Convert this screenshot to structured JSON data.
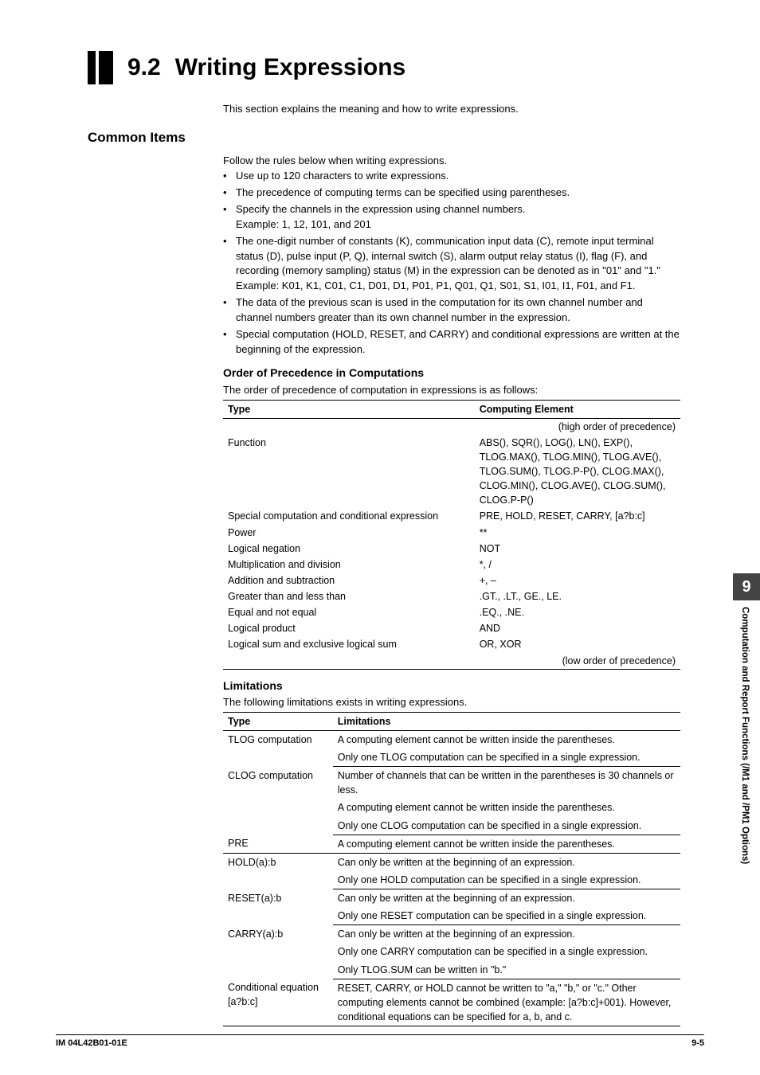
{
  "section": {
    "number": "9.2",
    "title": "Writing Expressions"
  },
  "intro": "This section explains the meaning and how to write expressions.",
  "common": {
    "heading": "Common Items",
    "lead": "Follow the rules below when writing expressions.",
    "bullets": {
      "b1": "Use up to 120 characters to write expressions.",
      "b2": "The precedence of computing terms can be specified using parentheses.",
      "b3a": "Specify the channels in the expression using channel numbers.",
      "b3b": "Example: 1, 12, 101, and 201",
      "b4a": "The one-digit number of constants (K), communication input data (C), remote input terminal status (D), pulse input (P, Q), internal switch (S), alarm output relay status (I), flag (F), and recording (memory sampling) status (M) in the expression can be denoted as in \"01\" and \"1.\"",
      "b4b": "Example: K01, K1, C01, C1, D01, D1, P01, P1, Q01, Q1, S01, S1, I01, I1, F01, and F1.",
      "b5": "The data of the previous scan is used in the computation for its own channel number and channel numbers greater than its own channel number in the expression.",
      "b6": "Special computation (HOLD, RESET, and CARRY) and conditional expressions are written at the beginning of the expression."
    }
  },
  "precedence": {
    "heading": "Order of Precedence in Computations",
    "lead": "The order of precedence of computation in expressions is as follows:",
    "headers": {
      "h1": "Type",
      "h2": "Computing Element"
    },
    "high": "(high order of precedence)",
    "rows": {
      "r1a": "Function",
      "r1b": "ABS(), SQR(), LOG(), LN(), EXP(), TLOG.MAX(), TLOG.MIN(), TLOG.AVE(), TLOG.SUM(), TLOG.P-P(), CLOG.MAX(), CLOG.MIN(), CLOG.AVE(), CLOG.SUM(), CLOG.P-P()",
      "r2a": "Special computation and conditional expression",
      "r2b": "PRE, HOLD, RESET, CARRY, [a?b:c]",
      "r3a": "Power",
      "r3b": "**",
      "r4a": "Logical negation",
      "r4b": "NOT",
      "r5a": "Multiplication and division",
      "r5b": "*, /",
      "r6a": "Addition and subtraction",
      "r6b": "+, –",
      "r7a": "Greater than and less than",
      "r7b": ".GT., .LT., GE., LE.",
      "r8a": "Equal and not equal",
      "r8b": ".EQ., .NE.",
      "r9a": "Logical product",
      "r9b": "AND",
      "r10a": "Logical sum and exclusive logical sum",
      "r10b": "OR, XOR"
    },
    "low": "(low order of precedence)"
  },
  "limits": {
    "heading": "Limitations",
    "lead": "The following limitations exists in writing expressions.",
    "headers": {
      "h1": "Type",
      "h2": "Limitations"
    },
    "rows": {
      "r1a": "TLOG computation",
      "r1b1": "A computing element cannot be written inside the parentheses.",
      "r1b2": "Only one TLOG computation can be specified in a single expression.",
      "r2a": "CLOG computation",
      "r2b1": "Number of channels that can be written in the parentheses is 30 channels or less.",
      "r2b2": "A computing element cannot be written inside the parentheses.",
      "r2b3": "Only one CLOG computation can be specified in a single expression.",
      "r3a": "PRE",
      "r3b": "A computing element cannot be written inside the parentheses.",
      "r4a": "HOLD(a):b",
      "r4b1": "Can only be written at the beginning of an expression.",
      "r4b2": "Only one HOLD computation can be specified in a single expression.",
      "r5a": "RESET(a):b",
      "r5b1": "Can only be written at the beginning of an expression.",
      "r5b2": "Only one RESET computation can be specified in a single expression.",
      "r6a": "CARRY(a):b",
      "r6b1": "Can only be written at the beginning of an expression.",
      "r6b2": "Only one CARRY computation can be specified in a single expression.",
      "r6b3": "Only TLOG.SUM can be written in \"b.\"",
      "r7a": "Conditional equation [a?b:c]",
      "r7b": "RESET, CARRY, or HOLD cannot be written to \"a,\" \"b,\" or \"c.\" Other computing elements cannot be combined (example: [a?b:c]+001). However, conditional equations can be specified for a, b, and c."
    }
  },
  "side": {
    "num": "9",
    "text": "Computation and Report Functions (/M1 and /PM1 Options)"
  },
  "footer": {
    "left": "IM 04L42B01-01E",
    "right": "9-5"
  }
}
